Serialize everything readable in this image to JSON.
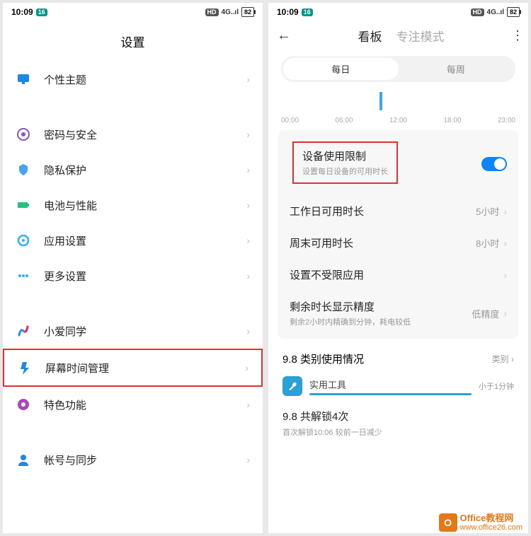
{
  "status": {
    "time": "10:09",
    "app_badge": "16",
    "net": "4G",
    "signal": "⁴ᴳ",
    "battery": "82"
  },
  "left": {
    "title": "设置",
    "groups": [
      [
        {
          "label": "个性主题",
          "icon": "theme"
        }
      ],
      [
        {
          "label": "密码与安全",
          "icon": "security"
        },
        {
          "label": "隐私保护",
          "icon": "privacy"
        },
        {
          "label": "电池与性能",
          "icon": "battery"
        },
        {
          "label": "应用设置",
          "icon": "apps"
        },
        {
          "label": "更多设置",
          "icon": "more"
        }
      ],
      [
        {
          "label": "小爱同学",
          "icon": "xiaoai"
        },
        {
          "label": "屏幕时间管理",
          "icon": "screentime",
          "highlight": true
        },
        {
          "label": "特色功能",
          "icon": "feature"
        }
      ],
      [
        {
          "label": "帐号与同步",
          "icon": "account"
        }
      ]
    ]
  },
  "right": {
    "tabs": {
      "dashboard": "看板",
      "focus": "专注模式"
    },
    "segment": {
      "daily": "每日",
      "weekly": "每周"
    },
    "timeline": [
      "00:00",
      "06:00",
      "12:00",
      "18:00",
      "23:00"
    ],
    "limit": {
      "title": "设备使用限制",
      "sub": "设置每日设备的可用时长",
      "toggle": true,
      "rows": [
        {
          "title": "工作日可用时长",
          "value": "5小时"
        },
        {
          "title": "周末可用时长",
          "value": "8小时"
        },
        {
          "title": "设置不受限应用",
          "value": ""
        },
        {
          "title": "剩余时长显示精度",
          "sub": "剩余2小时内精确到分钟，耗电较低",
          "value": "低精度"
        }
      ]
    },
    "usage": {
      "header": "9.8 类别使用情况",
      "tag": "类别",
      "items": [
        {
          "name": "实用工具",
          "time": "小于1分钟"
        }
      ]
    },
    "unlock": {
      "title": "9.8 共解锁4次",
      "sub": "首次解锁10:06  较前一日减少"
    }
  },
  "watermark": {
    "top": "Office教程网",
    "bottom": "www.office26.com"
  }
}
